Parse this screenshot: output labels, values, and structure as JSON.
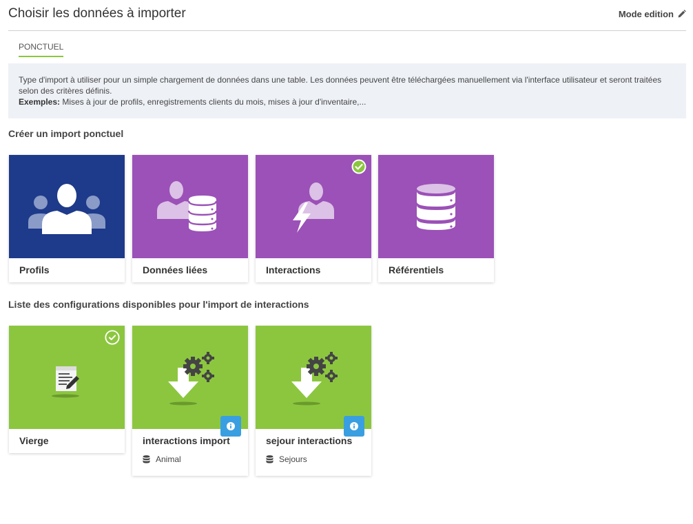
{
  "header": {
    "title": "Choisir les données à importer",
    "mode_label": "Mode edition",
    "mode_icon": "pencil-icon"
  },
  "tabs": [
    {
      "label": "PONCTUEL",
      "active": true
    }
  ],
  "info": {
    "text": "Type d'import à utiliser pour un simple chargement de données dans une table. Les données peuvent être téléchargées manuellement via l'interface utilisateur et seront traitées selon des critères définis.",
    "examples_label": "Exemples:",
    "examples_text": " Mises à jour de profils, enregistrements clients du mois, mises à jour d'inventaire,..."
  },
  "section_import": {
    "title": "Créer un import ponctuel",
    "cards": [
      {
        "label": "Profils",
        "color": "#1e3a8a",
        "icon": "users-icon",
        "selected": false
      },
      {
        "label": "Données liées",
        "color": "#9b51b7",
        "icon": "user-database-icon",
        "selected": false
      },
      {
        "label": "Interactions",
        "color": "#9b51b7",
        "icon": "user-lightning-icon",
        "selected": true
      },
      {
        "label": "Référentiels",
        "color": "#9b51b7",
        "icon": "database-icon",
        "selected": false
      }
    ]
  },
  "section_config": {
    "title": "Liste des configurations disponibles pour l'import de interactions",
    "cards": [
      {
        "label": "Vierge",
        "color": "#8cc63f",
        "icon": "document-edit-icon",
        "selected": true
      },
      {
        "label": "interactions import",
        "color": "#8cc63f",
        "icon": "download-gears-icon",
        "table": "Animal",
        "table_icon": "database-icon"
      },
      {
        "label": "sejour interactions",
        "color": "#8cc63f",
        "icon": "download-gears-icon",
        "table": "Sejours",
        "table_icon": "database-icon"
      }
    ]
  },
  "colors": {
    "accent_green": "#8cc63f",
    "navy": "#1e3a8a",
    "purple": "#9b51b7",
    "info_blue": "#3a9fe0"
  }
}
